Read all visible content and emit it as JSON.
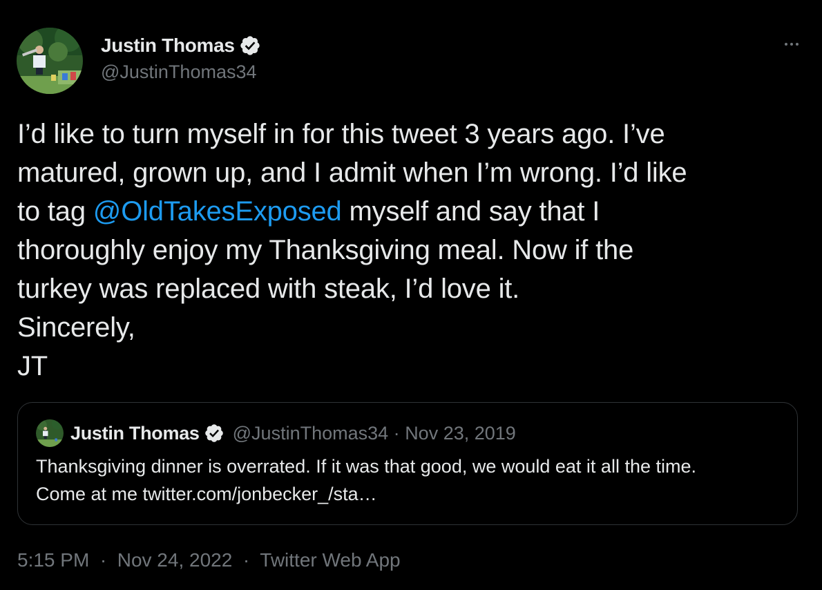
{
  "author": {
    "name": "Justin Thomas",
    "handle": "@JustinThomas34",
    "verified": true
  },
  "tweet": {
    "lines": [
      {
        "before": "I’d like to turn myself in for this tweet 3 years ago. I’ve"
      },
      {
        "before": "matured, grown up, and I admit when I’m wrong. I’d like"
      },
      {
        "before": "to tag ",
        "mention": "@OldTakesExposed",
        "after": " myself and say that I"
      },
      {
        "before": "thoroughly enjoy my Thanksgiving meal. Now if the"
      },
      {
        "before": "turkey was replaced with steak, I’d love it."
      },
      {
        "before": "Sincerely,"
      },
      {
        "before": "JT"
      }
    ]
  },
  "quote_tweet": {
    "name": "Justin Thomas",
    "handle": "@JustinThomas34",
    "separator": "·",
    "date": "Nov 23, 2019",
    "text_lines": [
      "Thanksgiving dinner is overrated. If it was that good, we would eat it all the time.",
      "Come at me twitter.com/jonbecker_/sta…"
    ]
  },
  "footer": {
    "time": "5:15 PM",
    "separator": "·",
    "date": "Nov 24, 2022",
    "source": "Twitter Web App"
  },
  "colors": {
    "background": "#000000",
    "text": "#e7e9ea",
    "secondary": "#71767b",
    "link": "#1d9bf0",
    "border": "#2f3336",
    "verified": "#e7e9ea"
  },
  "icons": {
    "verified": "verified-badge-icon",
    "more": "more-dots-icon"
  }
}
